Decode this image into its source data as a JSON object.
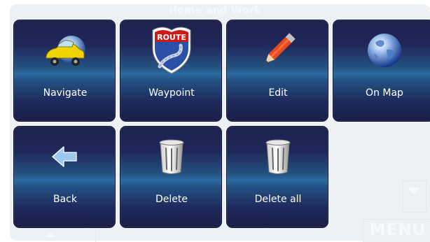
{
  "background": {
    "title": "Home and Work",
    "menu_label": "MENU"
  },
  "tiles": [
    {
      "label": "Navigate",
      "icon": "car-globe-icon"
    },
    {
      "label": "Waypoint",
      "icon": "route-sign-icon"
    },
    {
      "label": "Edit",
      "icon": "pencil-icon"
    },
    {
      "label": "On Map",
      "icon": "globe-icon"
    },
    {
      "label": "Back",
      "icon": "back-arrow-icon"
    },
    {
      "label": "Delete",
      "icon": "trash-can-icon"
    },
    {
      "label": "Delete all",
      "icon": "trash-can-icon"
    }
  ],
  "route_sign_text": "ROUTE",
  "colors": {
    "tile_dark": "#1d214d",
    "tile_band": "#2a6aa0",
    "label": "#ffffff"
  }
}
